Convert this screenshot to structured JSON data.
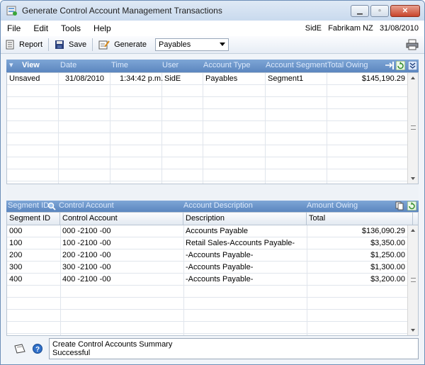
{
  "window": {
    "title": "Generate Control Account Management Transactions"
  },
  "menu": {
    "items": [
      "File",
      "Edit",
      "Tools",
      "Help"
    ],
    "user": "SidE",
    "company": "Fabrikam NZ",
    "date": "31/08/2010"
  },
  "toolbar": {
    "report_label": "Report",
    "save_label": "Save",
    "generate_label": "Generate",
    "combo_value": "Payables"
  },
  "grid1": {
    "view_label": "View",
    "columns": [
      "Date",
      "Time",
      "User",
      "Account Type",
      "Account Segment",
      "Total Owing"
    ],
    "rows": [
      {
        "status": "Unsaved",
        "date": "31/08/2010",
        "time": "1:34:42 p.m.",
        "user": "SidE",
        "account_type": "Payables",
        "segment": "Segment1",
        "total": "$145,190.29"
      }
    ]
  },
  "grid2": {
    "header_fields": [
      "Segment ID",
      "Control Account",
      "Account Description",
      "Amount Owing"
    ],
    "columns": [
      "Segment ID",
      "Control Account",
      "Description",
      "Total"
    ],
    "rows": [
      {
        "segment_id": "000",
        "control_account": "000 -2100 -00",
        "description": "Accounts Payable",
        "total": "$136,090.29"
      },
      {
        "segment_id": "100",
        "control_account": "100 -2100 -00",
        "description": "Retail Sales-Accounts Payable-",
        "total": "$3,350.00"
      },
      {
        "segment_id": "200",
        "control_account": "200 -2100 -00",
        "description": " -Accounts Payable-",
        "total": "$1,250.00"
      },
      {
        "segment_id": "300",
        "control_account": "300 -2100 -00",
        "description": " -Accounts Payable-",
        "total": "$1,300.00"
      },
      {
        "segment_id": "400",
        "control_account": "400 -2100 -00",
        "description": " -Accounts Payable-",
        "total": "$3,200.00"
      }
    ]
  },
  "status": {
    "line1": "Create Control Accounts Summary",
    "line2": "Successful"
  }
}
